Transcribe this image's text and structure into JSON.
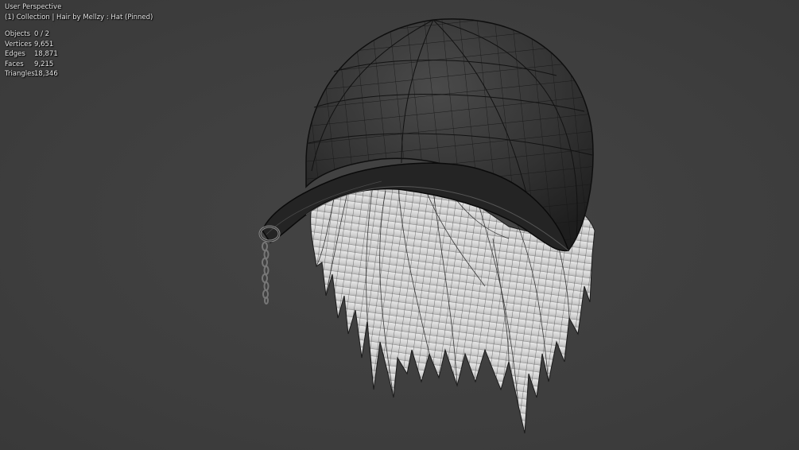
{
  "viewport": {
    "view_name": "User Perspective",
    "collection_info": "(1) Collection | Hair by Mellzy : Hat (Pinned)",
    "background_color": "#3d3d3d",
    "stats": [
      {
        "label": "Objects",
        "value": "0 / 2"
      },
      {
        "label": "Vertices",
        "value": "9,651"
      },
      {
        "label": "Edges",
        "value": "18,871"
      },
      {
        "label": "Faces",
        "value": "9,215"
      },
      {
        "label": "Triangles",
        "value": "18,346"
      }
    ]
  },
  "model": {
    "hat_color": "#2e2e2e",
    "hair_color": "#d9d9d9",
    "wire_color": "#111111"
  }
}
